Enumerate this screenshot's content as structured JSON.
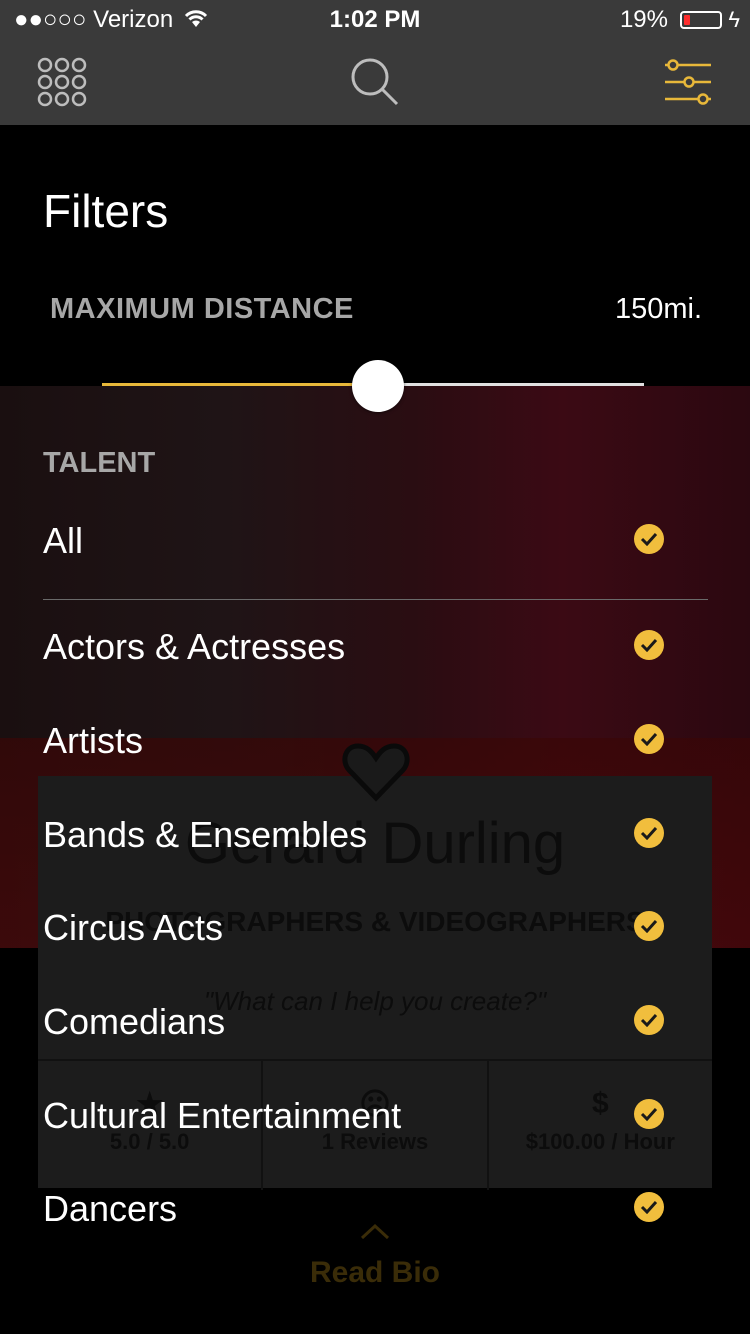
{
  "status_bar": {
    "carrier": "●●○○○ Verizon",
    "time": "1:02 PM",
    "battery_pct": "19%",
    "battery_level": 0.19
  },
  "nav": {
    "grid_icon": "grid-icon",
    "search_icon": "search-icon",
    "filter_icon": "sliders-icon",
    "accent": "#e8b83a"
  },
  "filters": {
    "title": "Filters",
    "distance": {
      "label": "MAXIMUM DISTANCE",
      "value_text": "150mi.",
      "fraction": 0.51
    },
    "talent": {
      "label": "TALENT",
      "items": [
        {
          "label": "All",
          "checked": true
        },
        {
          "label": "Actors & Actresses",
          "checked": true
        },
        {
          "label": "Artists",
          "checked": true
        },
        {
          "label": "Bands & Ensembles",
          "checked": true
        },
        {
          "label": "Circus Acts",
          "checked": true
        },
        {
          "label": "Comedians",
          "checked": true
        },
        {
          "label": "Cultural Entertainment",
          "checked": true
        },
        {
          "label": "Dancers",
          "checked": true
        }
      ]
    }
  },
  "background_card": {
    "name": "Gerard Durling",
    "category": "PHOTOGRAPHERS & VIDEOGRAPHERS",
    "quote": "\"What can I help you create?\"",
    "stats": [
      {
        "icon": "★",
        "value": "5.0 / 5.0"
      },
      {
        "icon": "☹",
        "value": "1 Reviews"
      },
      {
        "icon": "$",
        "value": "$100.00 / Hour"
      }
    ],
    "read_bio": "Read Bio"
  },
  "colors": {
    "check": "#f1be3d",
    "bar": "#3a3a3a"
  }
}
